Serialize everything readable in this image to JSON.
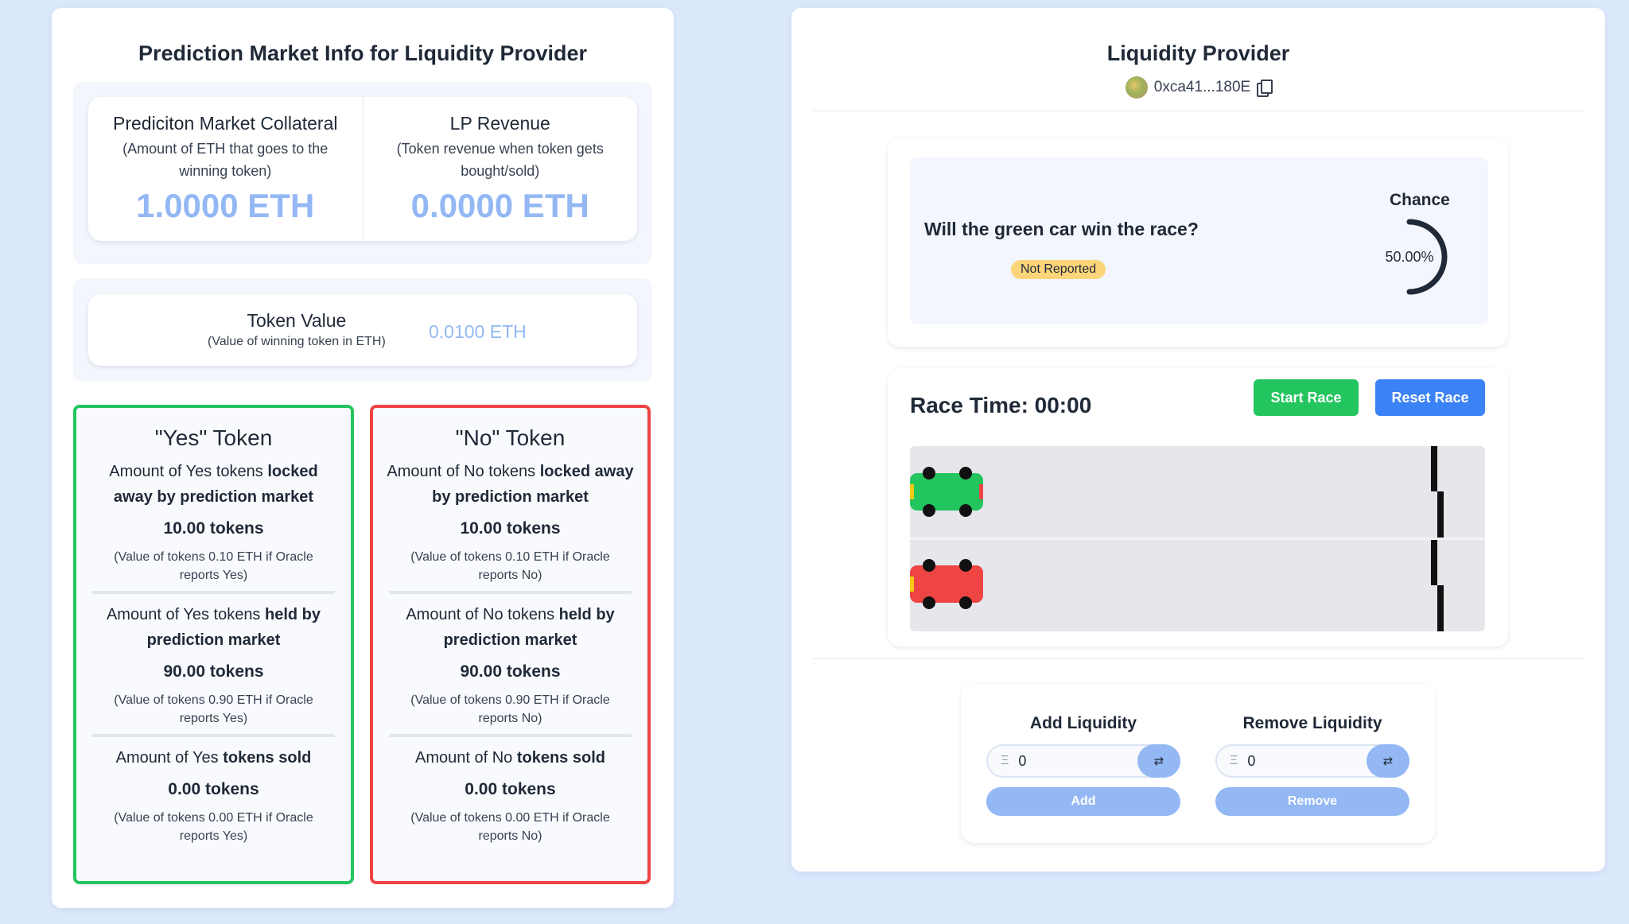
{
  "left": {
    "title": "Prediction Market Info for Liquidity Provider",
    "collateral": {
      "title": "Prediciton Market Collateral",
      "desc": "(Amount of ETH that goes to the winning token)",
      "value": "1.0000 ETH"
    },
    "revenue": {
      "title": "LP Revenue",
      "desc": "(Token revenue when token gets bought/sold)",
      "value": "0.0000 ETH"
    },
    "token_value": {
      "title": "Token Value",
      "desc": "(Value of winning token in ETH)",
      "value": "0.0100 ETH"
    },
    "yes": {
      "title": "\"Yes\" Token",
      "locked_pre": "Amount of Yes tokens ",
      "locked_bold": "locked away by prediction market",
      "locked_amount": "10.00 tokens",
      "locked_note": "(Value of tokens 0.10 ETH if Oracle reports Yes)",
      "held_pre": "Amount of Yes tokens ",
      "held_bold": "held by prediction market",
      "held_amount": "90.00 tokens",
      "held_note": "(Value of tokens 0.90 ETH if Oracle reports Yes)",
      "sold_pre": "Amount of Yes ",
      "sold_bold": "tokens sold",
      "sold_amount": "0.00 tokens",
      "sold_note": "(Value of tokens 0.00 ETH if Oracle reports Yes)"
    },
    "no": {
      "title": "\"No\" Token",
      "locked_pre": "Amount of No tokens ",
      "locked_bold": "locked away by prediction market",
      "locked_amount": "10.00 tokens",
      "locked_note": "(Value of tokens 0.10 ETH if Oracle reports No)",
      "held_pre": "Amount of No tokens ",
      "held_bold": "held by prediction market",
      "held_amount": "90.00 tokens",
      "held_note": "(Value of tokens 0.90 ETH if Oracle reports No)",
      "sold_pre": "Amount of No ",
      "sold_bold": "tokens sold",
      "sold_amount": "0.00 tokens",
      "sold_note": "(Value of tokens 0.00 ETH if Oracle reports No)"
    }
  },
  "right": {
    "title": "Liquidity Provider",
    "address": "0xca41...180E",
    "market": {
      "question": "Will the green car win the race?",
      "status": "Not Reported",
      "chance_label": "Chance",
      "chance_value": "50.00%",
      "chance_fraction": 0.5
    },
    "race": {
      "time_label": "Race Time: 00:00",
      "start_label": "Start Race",
      "reset_label": "Reset Race",
      "cars": [
        {
          "color": "#22c55e",
          "progress": 0
        },
        {
          "color": "#ef4444",
          "progress": 0
        }
      ]
    },
    "liquidity": {
      "add_title": "Add Liquidity",
      "add_value": "0",
      "add_button": "Add",
      "remove_title": "Remove Liquidity",
      "remove_value": "0",
      "remove_button": "Remove",
      "eth_symbol": "Ξ",
      "swap_symbol": "⇄"
    }
  }
}
